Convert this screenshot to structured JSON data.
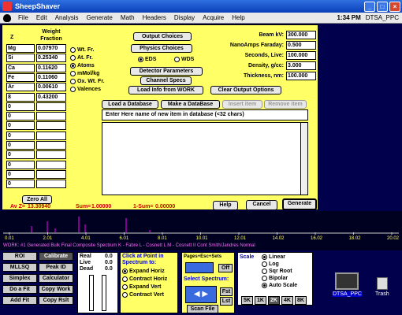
{
  "window": {
    "title": "SheepShaver"
  },
  "menubar": {
    "items": [
      "File",
      "Edit",
      "Analysis",
      "Generate",
      "Math",
      "Headers",
      "Display",
      "Acquire",
      "Help"
    ],
    "clock": "1:34 PM",
    "app": "DTSA_PPC"
  },
  "table": {
    "h1": "Z",
    "h2": "Weight Fraction",
    "rows": [
      [
        "Mg",
        "0.07970"
      ],
      [
        "Si",
        "0.25340"
      ],
      [
        "Ca",
        "0.11620"
      ],
      [
        "Fe",
        "0.11060"
      ],
      [
        "Ar",
        "0.00610"
      ],
      [
        "8",
        "0.43200"
      ],
      [
        "0",
        ""
      ],
      [
        "0",
        ""
      ],
      [
        "0",
        ""
      ],
      [
        "0",
        ""
      ],
      [
        "0",
        ""
      ],
      [
        "0",
        ""
      ],
      [
        "0",
        ""
      ],
      [
        "0",
        ""
      ],
      [
        "0",
        ""
      ]
    ],
    "zero_all": "Zero All",
    "avz_label": "Av Z=",
    "avz_value": "13.30940",
    "sum_label": "Sum=",
    "sum_value": "1.00000",
    "onesum_label": "1-Sum=",
    "onesum_value": "0.00000"
  },
  "fraction_options": {
    "items": [
      "Wt. Fr.",
      "At. Fr.",
      "Atoms",
      "mMol/kg",
      "Ox. Wt. Fr.",
      "Valences"
    ],
    "selected": 2
  },
  "buttons": {
    "output_choices": "Output Choices",
    "physics_choices": "Physics Choices",
    "detector": "Detector Parameters",
    "channel": "Channel Specs",
    "load_work": "Load Info from WORK",
    "clear_output": "Clear Output Options",
    "load_db": "Load a Database",
    "make_db": "Make a DataBase",
    "insert": "Insert item",
    "remove": "Remove item",
    "help": "Help",
    "cancel": "Cancel",
    "generate": "Generate"
  },
  "detector_type": {
    "items": [
      "EDS",
      "WDS"
    ],
    "selected": 0
  },
  "params": [
    {
      "label": "Beam kV:",
      "value": "300.000"
    },
    {
      "label": "NanoAmps Faraday:",
      "value": "0.500"
    },
    {
      "label": "Seconds, Live:",
      "value": "100.000"
    },
    {
      "label": "Density, g/cc:",
      "value": "3.000"
    },
    {
      "label": "Thickness, nm:",
      "value": "100.000"
    }
  ],
  "db_hint": "Enter Here name of new item in database (<32 chars)",
  "spectrum": {
    "ticks": [
      "0.01",
      "2.01",
      "4.01",
      "6.01",
      "8.01",
      "10.01",
      "12.01",
      "14.02",
      "16.02",
      "18.02",
      "20.02"
    ],
    "caption": "WORK: #1 Generated Bulk Final Composite Spectrum  K - Fabre L - Cosnett L M - Cosnett II Cont Smith/Jandres Normal"
  },
  "tools": {
    "left": [
      [
        "ROI",
        "Calibrate"
      ],
      [
        "MLLSQ",
        "Peak ID"
      ],
      [
        "Simplex",
        "Calculator"
      ],
      [
        "Do a Fit",
        "Copy Work"
      ],
      [
        "Add Fit",
        "Copy Rslt"
      ]
    ],
    "readout": {
      "real": "0.0",
      "live": "0.0",
      "dead": "0.0",
      "real_l": "Real",
      "live_l": "Live",
      "dead_l": "Dead"
    },
    "click_title": "Click at Point in Spectrum to:",
    "click_opts": [
      "Expand Horiz",
      "Contract Horiz",
      "Expand Vert",
      "Contract Vert"
    ],
    "pages": "Pages+Esc+Sets",
    "off": "Off",
    "select": "Select Spectrum:",
    "fst": "Fst",
    "lst": "Lst",
    "scan": "Scan File",
    "scale_title": "Scale",
    "scale_opts": [
      "Linear",
      "Log",
      "Sqr Root",
      "Bipolar",
      "Auto Scale"
    ],
    "scale_btns": [
      "5K",
      "1K",
      "2K",
      "4K",
      "8K"
    ]
  },
  "desktop": {
    "icon1": "DTSA_PPC",
    "icon2": "Trash"
  }
}
